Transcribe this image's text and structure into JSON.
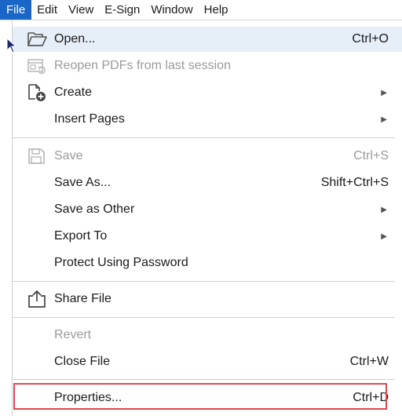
{
  "menubar": {
    "items": [
      "File",
      "Edit",
      "View",
      "E-Sign",
      "Window",
      "Help"
    ]
  },
  "menu": {
    "open": {
      "label": "Open...",
      "shortcut": "Ctrl+O",
      "icon": "folder-open-icon"
    },
    "reopen": {
      "label": "Reopen PDFs from last session",
      "icon": "reopen-session-icon"
    },
    "create": {
      "label": "Create",
      "icon": "create-pdf-icon"
    },
    "insert_pages": {
      "label": "Insert Pages"
    },
    "save": {
      "label": "Save",
      "shortcut": "Ctrl+S",
      "icon": "save-icon"
    },
    "save_as": {
      "label": "Save As...",
      "shortcut": "Shift+Ctrl+S"
    },
    "save_as_other": {
      "label": "Save as Other"
    },
    "export_to": {
      "label": "Export To"
    },
    "protect": {
      "label": "Protect Using Password"
    },
    "share": {
      "label": "Share File",
      "icon": "share-icon"
    },
    "revert": {
      "label": "Revert"
    },
    "close_file": {
      "label": "Close File",
      "shortcut": "Ctrl+W"
    },
    "properties": {
      "label": "Properties...",
      "shortcut": "Ctrl+D"
    }
  },
  "colors": {
    "accent": "#1a66c7",
    "hover": "#e6eef8",
    "highlight_box": "#e0484d",
    "disabled_text": "#9a9a9a"
  }
}
